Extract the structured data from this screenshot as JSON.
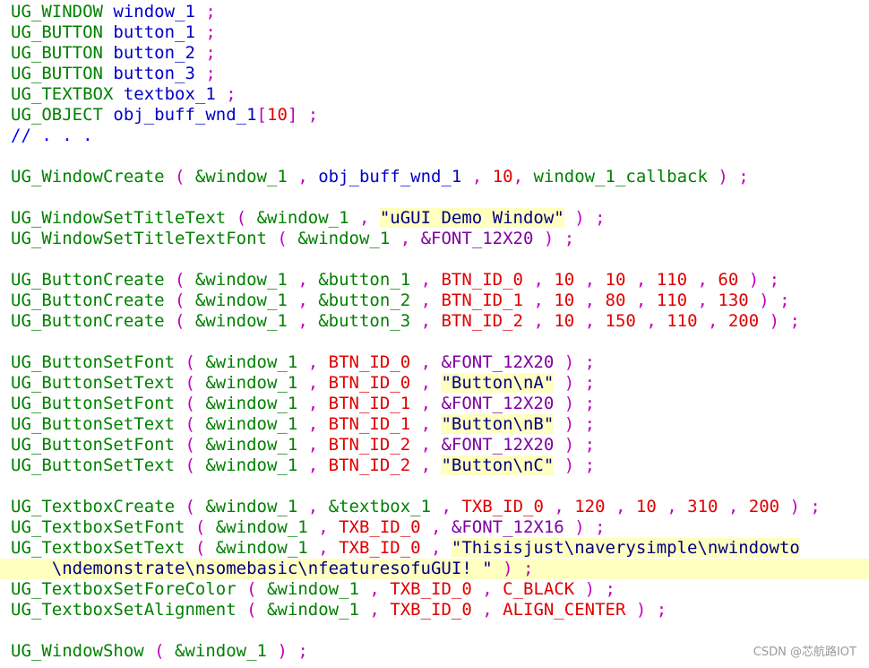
{
  "colors": {
    "type": "#008000",
    "function": "#008000",
    "ident": "#0000c8",
    "const": "#e00000",
    "string": "#000080",
    "macro": "#8000a0",
    "punct": "#c000c0",
    "comment": "#0000ff",
    "plain": "#0000c8"
  },
  "code": [
    [
      {
        "t": "UG_WINDOW ",
        "c": "type"
      },
      {
        "t": "window_1 ",
        "c": "ident"
      },
      {
        "t": ";",
        "c": "punct"
      }
    ],
    [
      {
        "t": "UG_BUTTON ",
        "c": "type"
      },
      {
        "t": "button_1 ",
        "c": "ident"
      },
      {
        "t": ";",
        "c": "punct"
      }
    ],
    [
      {
        "t": "UG_BUTTON ",
        "c": "type"
      },
      {
        "t": "button_2 ",
        "c": "ident"
      },
      {
        "t": ";",
        "c": "punct"
      }
    ],
    [
      {
        "t": "UG_BUTTON ",
        "c": "type"
      },
      {
        "t": "button_3 ",
        "c": "ident"
      },
      {
        "t": ";",
        "c": "punct"
      }
    ],
    [
      {
        "t": "UG_TEXTBOX ",
        "c": "type"
      },
      {
        "t": "textbox_1 ",
        "c": "ident"
      },
      {
        "t": ";",
        "c": "punct"
      }
    ],
    [
      {
        "t": "UG_OBJECT ",
        "c": "type"
      },
      {
        "t": "obj_buff_wnd_1",
        "c": "ident"
      },
      {
        "t": "[",
        "c": "punct"
      },
      {
        "t": "10",
        "c": "const"
      },
      {
        "t": "] ;",
        "c": "punct"
      }
    ],
    [
      {
        "t": "// . . .",
        "c": "comment"
      }
    ],
    [],
    [
      {
        "t": "UG_WindowCreate ",
        "c": "function"
      },
      {
        "t": "( ",
        "c": "punct"
      },
      {
        "t": "&window_1 ",
        "c": "function"
      },
      {
        "t": ", ",
        "c": "punct"
      },
      {
        "t": "obj_buff_wnd_1 ",
        "c": "ident"
      },
      {
        "t": ", ",
        "c": "punct"
      },
      {
        "t": "10",
        "c": "const"
      },
      {
        "t": ", ",
        "c": "punct"
      },
      {
        "t": "window_1_callback ",
        "c": "function"
      },
      {
        "t": ") ;",
        "c": "punct"
      }
    ],
    [],
    [
      {
        "t": "UG_WindowSetTitleText ",
        "c": "function"
      },
      {
        "t": "( ",
        "c": "punct"
      },
      {
        "t": "&window_1 ",
        "c": "function"
      },
      {
        "t": ", ",
        "c": "punct"
      },
      {
        "t": "\"uGUI Demo Window\"",
        "c": "string",
        "hl": true
      },
      {
        "t": " ) ;",
        "c": "punct"
      }
    ],
    [
      {
        "t": "UG_WindowSetTitleTextFont ",
        "c": "function"
      },
      {
        "t": "( ",
        "c": "punct"
      },
      {
        "t": "&window_1 ",
        "c": "function"
      },
      {
        "t": ", ",
        "c": "punct"
      },
      {
        "t": "&FONT_12X20 ",
        "c": "macro"
      },
      {
        "t": ") ;",
        "c": "punct"
      }
    ],
    [],
    [
      {
        "t": "UG_ButtonCreate ",
        "c": "function"
      },
      {
        "t": "( ",
        "c": "punct"
      },
      {
        "t": "&window_1 ",
        "c": "function"
      },
      {
        "t": ", ",
        "c": "punct"
      },
      {
        "t": "&button_1 ",
        "c": "function"
      },
      {
        "t": ", ",
        "c": "punct"
      },
      {
        "t": "BTN_ID_0 ",
        "c": "const"
      },
      {
        "t": ", ",
        "c": "punct"
      },
      {
        "t": "10 ",
        "c": "const"
      },
      {
        "t": ", ",
        "c": "punct"
      },
      {
        "t": "10 ",
        "c": "const"
      },
      {
        "t": ", ",
        "c": "punct"
      },
      {
        "t": "110 ",
        "c": "const"
      },
      {
        "t": ", ",
        "c": "punct"
      },
      {
        "t": "60 ",
        "c": "const"
      },
      {
        "t": ") ;",
        "c": "punct"
      }
    ],
    [
      {
        "t": "UG_ButtonCreate ",
        "c": "function"
      },
      {
        "t": "( ",
        "c": "punct"
      },
      {
        "t": "&window_1 ",
        "c": "function"
      },
      {
        "t": ", ",
        "c": "punct"
      },
      {
        "t": "&button_2 ",
        "c": "function"
      },
      {
        "t": ", ",
        "c": "punct"
      },
      {
        "t": "BTN_ID_1 ",
        "c": "const"
      },
      {
        "t": ", ",
        "c": "punct"
      },
      {
        "t": "10 ",
        "c": "const"
      },
      {
        "t": ", ",
        "c": "punct"
      },
      {
        "t": "80 ",
        "c": "const"
      },
      {
        "t": ", ",
        "c": "punct"
      },
      {
        "t": "110 ",
        "c": "const"
      },
      {
        "t": ", ",
        "c": "punct"
      },
      {
        "t": "130 ",
        "c": "const"
      },
      {
        "t": ") ;",
        "c": "punct"
      }
    ],
    [
      {
        "t": "UG_ButtonCreate ",
        "c": "function"
      },
      {
        "t": "( ",
        "c": "punct"
      },
      {
        "t": "&window_1 ",
        "c": "function"
      },
      {
        "t": ", ",
        "c": "punct"
      },
      {
        "t": "&button_3 ",
        "c": "function"
      },
      {
        "t": ", ",
        "c": "punct"
      },
      {
        "t": "BTN_ID_2 ",
        "c": "const"
      },
      {
        "t": ", ",
        "c": "punct"
      },
      {
        "t": "10 ",
        "c": "const"
      },
      {
        "t": ", ",
        "c": "punct"
      },
      {
        "t": "150 ",
        "c": "const"
      },
      {
        "t": ", ",
        "c": "punct"
      },
      {
        "t": "110 ",
        "c": "const"
      },
      {
        "t": ", ",
        "c": "punct"
      },
      {
        "t": "200 ",
        "c": "const"
      },
      {
        "t": ") ;",
        "c": "punct"
      }
    ],
    [],
    [
      {
        "t": "UG_ButtonSetFont ",
        "c": "function"
      },
      {
        "t": "( ",
        "c": "punct"
      },
      {
        "t": "&window_1 ",
        "c": "function"
      },
      {
        "t": ", ",
        "c": "punct"
      },
      {
        "t": "BTN_ID_0 ",
        "c": "const"
      },
      {
        "t": ", ",
        "c": "punct"
      },
      {
        "t": "&FONT_12X20 ",
        "c": "macro"
      },
      {
        "t": ") ;",
        "c": "punct"
      }
    ],
    [
      {
        "t": "UG_ButtonSetText ",
        "c": "function"
      },
      {
        "t": "( ",
        "c": "punct"
      },
      {
        "t": "&window_1 ",
        "c": "function"
      },
      {
        "t": ", ",
        "c": "punct"
      },
      {
        "t": "BTN_ID_0 ",
        "c": "const"
      },
      {
        "t": ", ",
        "c": "punct"
      },
      {
        "t": "\"Button\\nA\"",
        "c": "string",
        "hl": true
      },
      {
        "t": " ) ;",
        "c": "punct"
      }
    ],
    [
      {
        "t": "UG_ButtonSetFont ",
        "c": "function"
      },
      {
        "t": "( ",
        "c": "punct"
      },
      {
        "t": "&window_1 ",
        "c": "function"
      },
      {
        "t": ", ",
        "c": "punct"
      },
      {
        "t": "BTN_ID_1 ",
        "c": "const"
      },
      {
        "t": ", ",
        "c": "punct"
      },
      {
        "t": "&FONT_12X20 ",
        "c": "macro"
      },
      {
        "t": ") ;",
        "c": "punct"
      }
    ],
    [
      {
        "t": "UG_ButtonSetText ",
        "c": "function"
      },
      {
        "t": "( ",
        "c": "punct"
      },
      {
        "t": "&window_1 ",
        "c": "function"
      },
      {
        "t": ", ",
        "c": "punct"
      },
      {
        "t": "BTN_ID_1 ",
        "c": "const"
      },
      {
        "t": ", ",
        "c": "punct"
      },
      {
        "t": "\"Button\\nB\"",
        "c": "string",
        "hl": true
      },
      {
        "t": " ) ;",
        "c": "punct"
      }
    ],
    [
      {
        "t": "UG_ButtonSetFont ",
        "c": "function"
      },
      {
        "t": "( ",
        "c": "punct"
      },
      {
        "t": "&window_1 ",
        "c": "function"
      },
      {
        "t": ", ",
        "c": "punct"
      },
      {
        "t": "BTN_ID_2 ",
        "c": "const"
      },
      {
        "t": ", ",
        "c": "punct"
      },
      {
        "t": "&FONT_12X20 ",
        "c": "macro"
      },
      {
        "t": ") ;",
        "c": "punct"
      }
    ],
    [
      {
        "t": "UG_ButtonSetText ",
        "c": "function"
      },
      {
        "t": "( ",
        "c": "punct"
      },
      {
        "t": "&window_1 ",
        "c": "function"
      },
      {
        "t": ", ",
        "c": "punct"
      },
      {
        "t": "BTN_ID_2 ",
        "c": "const"
      },
      {
        "t": ", ",
        "c": "punct"
      },
      {
        "t": "\"Button\\nC\"",
        "c": "string",
        "hl": true
      },
      {
        "t": " ) ;",
        "c": "punct"
      }
    ],
    [],
    [
      {
        "t": "UG_TextboxCreate ",
        "c": "function"
      },
      {
        "t": "( ",
        "c": "punct"
      },
      {
        "t": "&window_1 ",
        "c": "function"
      },
      {
        "t": ", ",
        "c": "punct"
      },
      {
        "t": "&textbox_1 ",
        "c": "function"
      },
      {
        "t": ", ",
        "c": "punct"
      },
      {
        "t": "TXB_ID_0 ",
        "c": "const"
      },
      {
        "t": ", ",
        "c": "punct"
      },
      {
        "t": "120 ",
        "c": "const"
      },
      {
        "t": ", ",
        "c": "punct"
      },
      {
        "t": "10 ",
        "c": "const"
      },
      {
        "t": ", ",
        "c": "punct"
      },
      {
        "t": "310 ",
        "c": "const"
      },
      {
        "t": ", ",
        "c": "punct"
      },
      {
        "t": "200 ",
        "c": "const"
      },
      {
        "t": ") ;",
        "c": "punct"
      }
    ],
    [
      {
        "t": "UG_TextboxSetFont ",
        "c": "function"
      },
      {
        "t": "( ",
        "c": "punct"
      },
      {
        "t": "&window_1 ",
        "c": "function"
      },
      {
        "t": ", ",
        "c": "punct"
      },
      {
        "t": "TXB_ID_0 ",
        "c": "const"
      },
      {
        "t": ", ",
        "c": "punct"
      },
      {
        "t": "&FONT_12X16 ",
        "c": "macro"
      },
      {
        "t": ") ;",
        "c": "punct"
      }
    ],
    [
      {
        "t": "UG_TextboxSetText ",
        "c": "function"
      },
      {
        "t": "( ",
        "c": "punct"
      },
      {
        "t": "&window_1 ",
        "c": "function"
      },
      {
        "t": ", ",
        "c": "punct"
      },
      {
        "t": "TXB_ID_0 ",
        "c": "const"
      },
      {
        "t": ", ",
        "c": "punct"
      },
      {
        "t": "\"Thisisjust\\naverysimple\\nwindowto",
        "c": "string",
        "hl": true
      }
    ],
    [
      {
        "t": "    \\ndemonstrate\\nsomebasic\\nfeaturesofuGUI! \"",
        "c": "string",
        "linehl": true
      },
      {
        "t": " ) ;",
        "c": "punct"
      }
    ],
    [
      {
        "t": "UG_TextboxSetForeColor ",
        "c": "function"
      },
      {
        "t": "( ",
        "c": "punct"
      },
      {
        "t": "&window_1 ",
        "c": "function"
      },
      {
        "t": ", ",
        "c": "punct"
      },
      {
        "t": "TXB_ID_0 ",
        "c": "const"
      },
      {
        "t": ", ",
        "c": "punct"
      },
      {
        "t": "C_BLACK ",
        "c": "const"
      },
      {
        "t": ") ;",
        "c": "punct"
      }
    ],
    [
      {
        "t": "UG_TextboxSetAlignment ",
        "c": "function"
      },
      {
        "t": "( ",
        "c": "punct"
      },
      {
        "t": "&window_1 ",
        "c": "function"
      },
      {
        "t": ", ",
        "c": "punct"
      },
      {
        "t": "TXB_ID_0 ",
        "c": "const"
      },
      {
        "t": ", ",
        "c": "punct"
      },
      {
        "t": "ALIGN_CENTER ",
        "c": "const"
      },
      {
        "t": ") ;",
        "c": "punct"
      }
    ],
    [],
    [
      {
        "t": "UG_WindowShow ",
        "c": "function"
      },
      {
        "t": "( ",
        "c": "punct"
      },
      {
        "t": "&window_1 ",
        "c": "function"
      },
      {
        "t": ") ;",
        "c": "punct"
      }
    ]
  ],
  "watermark": "CSDN @芯航路IOT"
}
